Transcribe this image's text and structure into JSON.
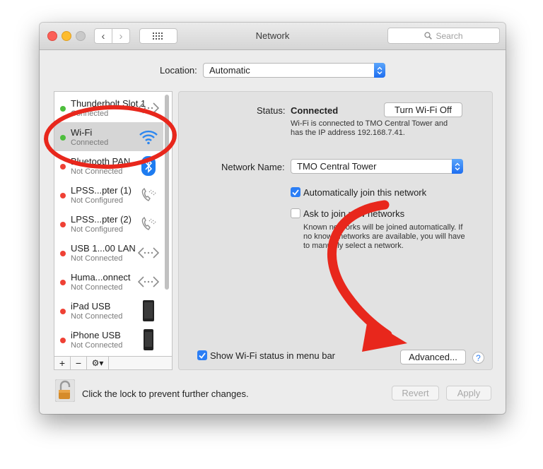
{
  "window": {
    "title": "Network",
    "search_placeholder": "Search",
    "nav_back": "‹",
    "nav_forward": "›"
  },
  "location": {
    "label": "Location:",
    "value": "Automatic"
  },
  "services": [
    {
      "name": "Thunderbolt Slot 1",
      "status": "Connected",
      "dot": "green",
      "icon": "ethernet-icon"
    },
    {
      "name": "Wi-Fi",
      "status": "Connected",
      "dot": "green",
      "icon": "wifi-icon",
      "selected": true
    },
    {
      "name": "Bluetooth PAN",
      "status": "Not Connected",
      "dot": "red",
      "icon": "bluetooth-icon"
    },
    {
      "name": "LPSS...pter (1)",
      "status": "Not Configured",
      "dot": "red",
      "icon": "phone-icon"
    },
    {
      "name": "LPSS...pter (2)",
      "status": "Not Configured",
      "dot": "red",
      "icon": "phone-icon"
    },
    {
      "name": "USB 1...00 LAN",
      "status": "Not Connected",
      "dot": "red",
      "icon": "ethernet-icon"
    },
    {
      "name": "Huma...onnect",
      "status": "Not Connected",
      "dot": "red",
      "icon": "ethernet-icon"
    },
    {
      "name": "iPad USB",
      "status": "Not Connected",
      "dot": "red",
      "icon": "ipad-icon"
    },
    {
      "name": "iPhone USB",
      "status": "Not Connected",
      "dot": "red",
      "icon": "iphone-icon"
    }
  ],
  "sidebar_footer": {
    "add": "+",
    "remove": "−",
    "gear": "⚙▾"
  },
  "detail": {
    "status_label": "Status:",
    "status_value": "Connected",
    "turn_off_button": "Turn Wi-Fi Off",
    "status_desc_line1": "Wi-Fi is connected to TMO Central Tower and",
    "status_desc_line2": "has the IP address 192.168.7.41.",
    "network_name_label": "Network Name:",
    "network_name_value": "TMO Central Tower",
    "auto_join_label": "Automatically join this network",
    "auto_join_checked": true,
    "ask_join_label": "Ask to join new networks",
    "ask_join_checked": false,
    "ask_join_desc_line1": "Known networks will be joined automatically. If",
    "ask_join_desc_line2": "no known networks are available, you will have",
    "ask_join_desc_line3": "to manually select a network.",
    "show_status_label": "Show Wi-Fi status in menu bar",
    "show_status_checked": true,
    "advanced_button": "Advanced...",
    "help": "?"
  },
  "bottom": {
    "lock_text": "Click the lock to prevent further changes.",
    "revert_button": "Revert",
    "apply_button": "Apply"
  },
  "colors": {
    "annotation_red": "#e8271c",
    "accent_blue": "#2b7ef5"
  }
}
